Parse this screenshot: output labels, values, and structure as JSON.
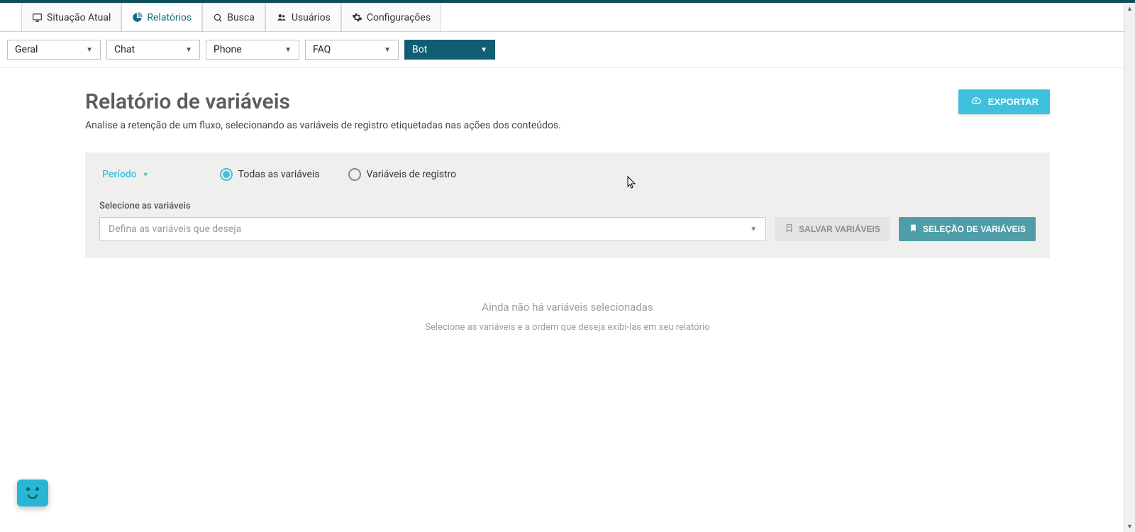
{
  "nav": {
    "tabs": [
      {
        "label": "Situação Atual",
        "icon": "monitor"
      },
      {
        "label": "Relatórios",
        "icon": "piechart",
        "active": true
      },
      {
        "label": "Busca",
        "icon": "search"
      },
      {
        "label": "Usuários",
        "icon": "users"
      },
      {
        "label": "Configurações",
        "icon": "gear"
      }
    ]
  },
  "filters": {
    "items": [
      {
        "label": "Geral"
      },
      {
        "label": "Chat"
      },
      {
        "label": "Phone"
      },
      {
        "label": "FAQ"
      },
      {
        "label": "Bot",
        "active": true
      }
    ]
  },
  "page": {
    "title": "Relatório de variáveis",
    "subtitle": "Analise a retenção de um fluxo, selecionando as variáveis de registro etiquetadas nas ações dos conteúdos.",
    "export_label": "EXPORTAR"
  },
  "panel": {
    "periodo_label": "Período",
    "radio": {
      "all": "Todas as variáveis",
      "registro": "Variáveis de registro",
      "selected": "all"
    },
    "select_title": "Selecione as variáveis",
    "select_placeholder": "Defina as variáveis que deseja",
    "save_vars": "SALVAR VARIÁVEIS",
    "selection_vars": "SELEÇÃO DE VARIÁVEIS"
  },
  "empty": {
    "title": "Ainda não há variáveis selecionadas",
    "sub": "Selecione as variáveis e a ordem que deseja exibi-las em seu relatório"
  }
}
